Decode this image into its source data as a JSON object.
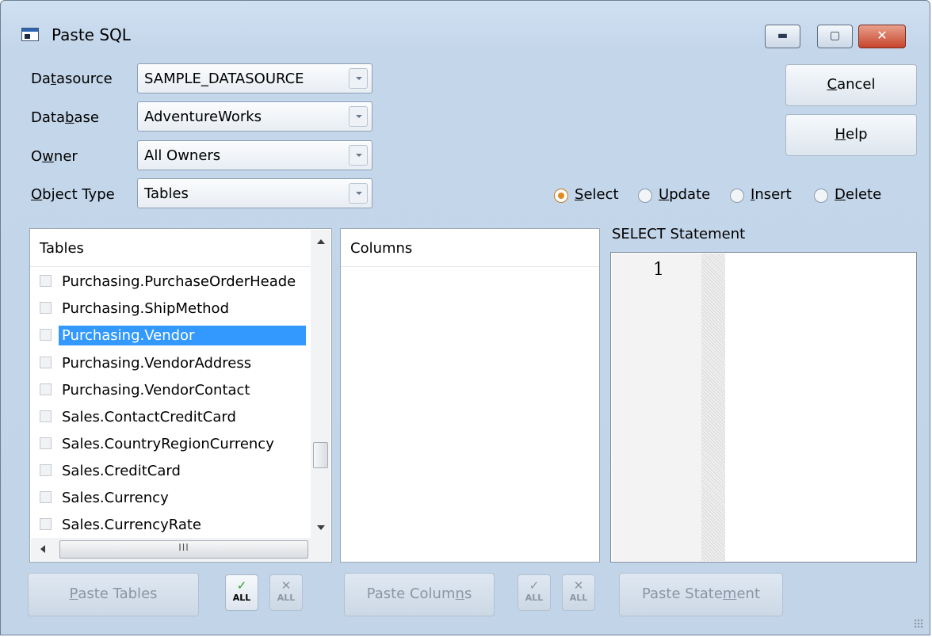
{
  "window": {
    "title": "Paste SQL",
    "controls": {
      "minimize": "▬",
      "maximize": "▢",
      "close": "✕"
    }
  },
  "fields": {
    "datasource": {
      "label_pre": "Da",
      "label_key": "t",
      "label_post": "asource",
      "value": "SAMPLE_DATASOURCE"
    },
    "database": {
      "label_pre": "Data",
      "label_key": "b",
      "label_post": "ase",
      "value": "AdventureWorks"
    },
    "owner": {
      "label_pre": "O",
      "label_key": "w",
      "label_post": "ner",
      "value": "All Owners"
    },
    "object_type": {
      "label_pre": "",
      "label_key": "O",
      "label_post": "bject Type",
      "value": "Tables"
    }
  },
  "buttons": {
    "cancel": {
      "key": "C",
      "rest": "ancel"
    },
    "help": {
      "key": "H",
      "rest": "elp"
    },
    "paste_tables": {
      "key": "P",
      "rest": "aste Tables"
    },
    "paste_columns": {
      "pre": "Paste Colum",
      "key": "n",
      "rest": "s"
    },
    "paste_statement": {
      "pre": "Paste State",
      "key": "m",
      "rest": "ent"
    },
    "all_label": "ALL"
  },
  "statement_types": [
    {
      "key": "S",
      "rest": "elect",
      "selected": true
    },
    {
      "key": "U",
      "rest": "pdate",
      "selected": false
    },
    {
      "key": "I",
      "rest": "nsert",
      "selected": false
    },
    {
      "key": "D",
      "rest": "elete",
      "selected": false
    }
  ],
  "tables_panel": {
    "header": "Tables",
    "items": [
      "Purchasing.PurchaseOrderHeade",
      "Purchasing.ShipMethod",
      "Purchasing.Vendor",
      "Purchasing.VendorAddress",
      "Purchasing.VendorContact",
      "Sales.ContactCreditCard",
      "Sales.CountryRegionCurrency",
      "Sales.CreditCard",
      "Sales.Currency",
      "Sales.CurrencyRate"
    ],
    "selected_item": "Purchasing.Vendor",
    "hscroll_grip": "III"
  },
  "columns_panel": {
    "header": "Columns"
  },
  "sql_panel": {
    "label": "SELECT Statement",
    "line_number": "1"
  },
  "icons": {
    "check_all": "check-all-icon",
    "uncheck_all": "uncheck-all-icon"
  },
  "colors": {
    "selection": "#3399ff",
    "window_bg": "#c4d6ea",
    "radio_selected": "#e38a1e"
  }
}
